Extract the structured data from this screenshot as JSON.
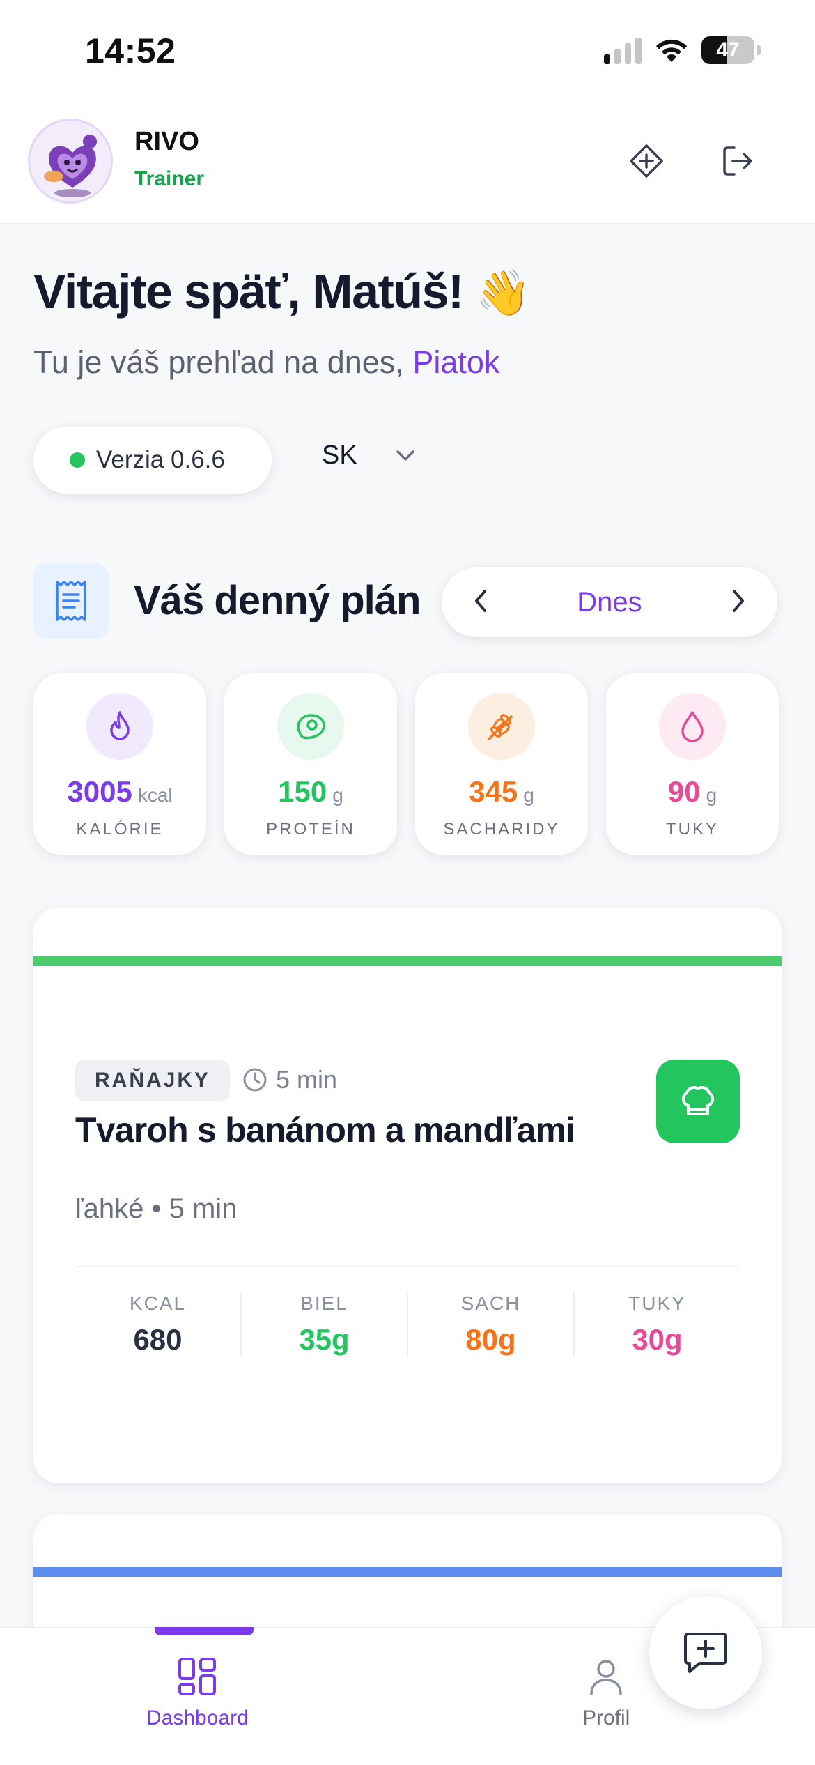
{
  "status_bar": {
    "time": "14:52",
    "battery": "47",
    "battery_level": 0.47
  },
  "header": {
    "brand": "RIVO",
    "role": "Trainer",
    "icons": {
      "left": "diamond-plus-icon",
      "right": "logout-icon"
    }
  },
  "greeting": {
    "title": "Vitajte späť, Matúš!",
    "emoji": "👋",
    "subtitle_prefix": "Tu je váš prehľad na dnes,",
    "day": "Piatok"
  },
  "version": {
    "label": "Verzia 0.6.6",
    "status_color": "#22c55e"
  },
  "language": {
    "selected": "SK"
  },
  "plan": {
    "title": "Váš denný plán",
    "day_label": "Dnes"
  },
  "macros": [
    {
      "value": "3005",
      "unit": "kcal",
      "label": "KALÓRIE",
      "icon": "flame-icon",
      "color": "#7c3aed",
      "bg": "#f1e9fd"
    },
    {
      "value": "150",
      "unit": "g",
      "label": "PROTEÍN",
      "icon": "steak-icon",
      "color": "#22c55e",
      "bg": "#e7f8ee"
    },
    {
      "value": "345",
      "unit": "g",
      "label": "SACHARIDY",
      "icon": "wheat-icon",
      "color": "#f97316",
      "bg": "#fdeee2"
    },
    {
      "value": "90",
      "unit": "g",
      "label": "TUKY",
      "icon": "droplet-icon",
      "color": "#ec4899",
      "bg": "#fdeaf3"
    }
  ],
  "meal": {
    "tag": "RAŇAJKY",
    "time": "5 min",
    "title": "Tvaroh s banánom a mandľami",
    "meta": "ľahké • 5 min",
    "stripe_color": "#4ccc6e",
    "stats": [
      {
        "label": "KCAL",
        "value": "680",
        "color": "#2b3040"
      },
      {
        "label": "BIEL",
        "value": "35g",
        "color": "#22c55e"
      },
      {
        "label": "SACH",
        "value": "80g",
        "color": "#f97316"
      },
      {
        "label": "TUKY",
        "value": "30g",
        "color": "#ec4899"
      }
    ]
  },
  "nav": {
    "dashboard": "Dashboard",
    "profile": "Profil",
    "active_color": "#7c3aed"
  }
}
